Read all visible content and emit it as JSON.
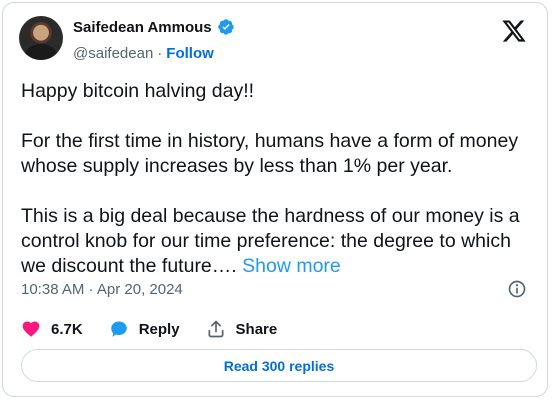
{
  "author": {
    "name": "Saifedean Ammous",
    "handle": "@saifedean",
    "separator": "·",
    "follow_label": "Follow",
    "verified": true
  },
  "icons": {
    "verified": "verified-badge-icon",
    "logo": "x-logo-icon",
    "info": "info-icon",
    "like": "heart-icon",
    "reply": "reply-bubble-icon",
    "share": "share-icon"
  },
  "colors": {
    "accent": "#1d9bf0",
    "link": "#006fd6",
    "heart": "#f91880",
    "border": "#cfd9de",
    "muted": "#536471"
  },
  "tweet": {
    "paragraph1": "Happy bitcoin halving day!!",
    "paragraph2": "For the first time in history, humans have a form of money whose supply increases by less than 1% per year.",
    "paragraph3": "This is a big deal because the hardness of our money is a control knob for our time preference: the degree to which we discount the future….",
    "show_more": "Show more",
    "timestamp": "10:38 AM · Apr 20, 2024"
  },
  "actions": {
    "likes": "6.7K",
    "reply_label": "Reply",
    "share_label": "Share"
  },
  "footer": {
    "read_replies": "Read 300 replies"
  }
}
